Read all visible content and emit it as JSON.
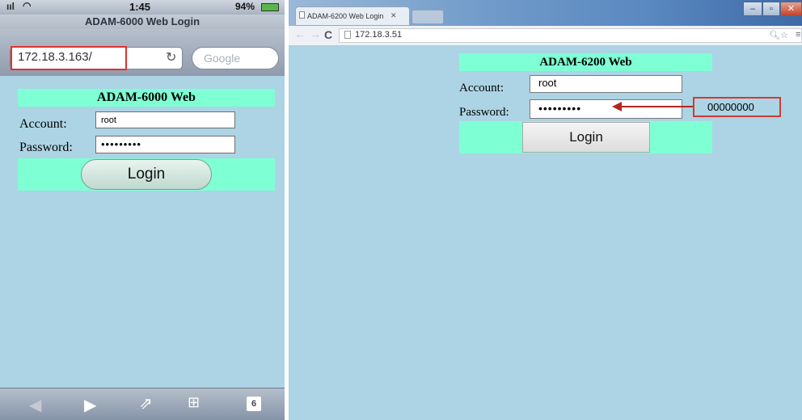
{
  "phone": {
    "status": {
      "time": "1:45",
      "battery": "94%"
    },
    "page_title": "ADAM-6000 Web Login",
    "url": "172.18.3.163/",
    "search_placeholder": "Google",
    "form": {
      "header": "ADAM-6000 Web",
      "account_label": "Account:",
      "account_value": "root",
      "password_label": "Password:",
      "password_mask": "•••••••••",
      "login_label": "Login"
    },
    "toolbar": {
      "tabs_count": "6"
    }
  },
  "browser": {
    "tab_title": "ADAM-6200 Web Login",
    "address": "172.18.3.51",
    "form": {
      "header": "ADAM-6200 Web",
      "account_label": "Account:",
      "account_value": "root",
      "password_label": "Password:",
      "password_mask": "•••••••••",
      "login_label": "Login"
    },
    "annotation": "00000000"
  },
  "colors": {
    "page_bg": "#acd4e4",
    "header_bg": "#7fffd4",
    "highlight_red": "#e0322f"
  }
}
